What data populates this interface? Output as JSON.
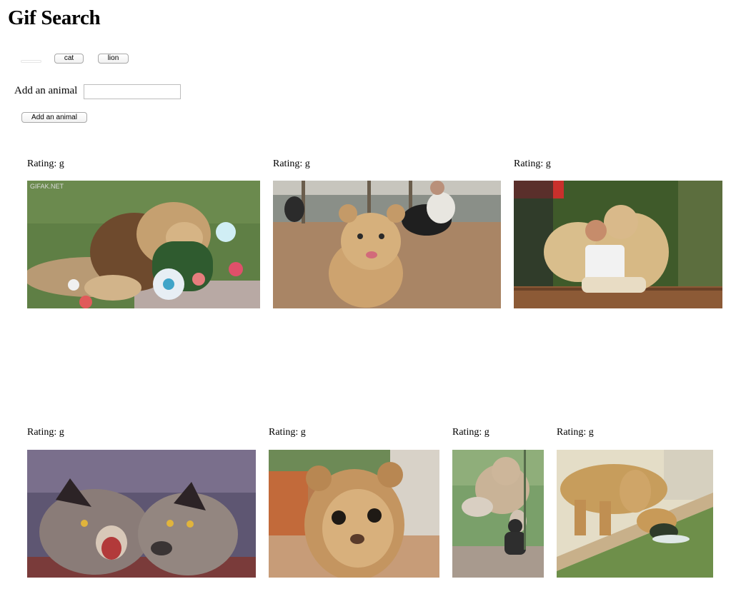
{
  "page": {
    "title": "Gif Search"
  },
  "buttons": [
    {
      "label": ""
    },
    {
      "label": "cat"
    },
    {
      "label": "lion"
    }
  ],
  "form": {
    "label": "Add an animal",
    "input_value": "",
    "input_placeholder": "",
    "submit_label": "Add an animal"
  },
  "gifs": [
    {
      "rating": "Rating: g",
      "subject": "lion-playing-with-flowers",
      "watermark": "GIFAK.NET"
    },
    {
      "rating": "Rating: g",
      "subject": "lion-cub-running-toward-camera"
    },
    {
      "rating": "Rating: g",
      "subject": "man-hugging-lions"
    },
    {
      "rating": "Rating: g",
      "subject": "cartoon-hyenas"
    },
    {
      "rating": "Rating: g",
      "subject": "lion-cub-closeup"
    },
    {
      "rating": "Rating: g",
      "subject": "lioness-and-child-at-glass"
    },
    {
      "rating": "Rating: g",
      "subject": "lioness-at-water"
    }
  ]
}
